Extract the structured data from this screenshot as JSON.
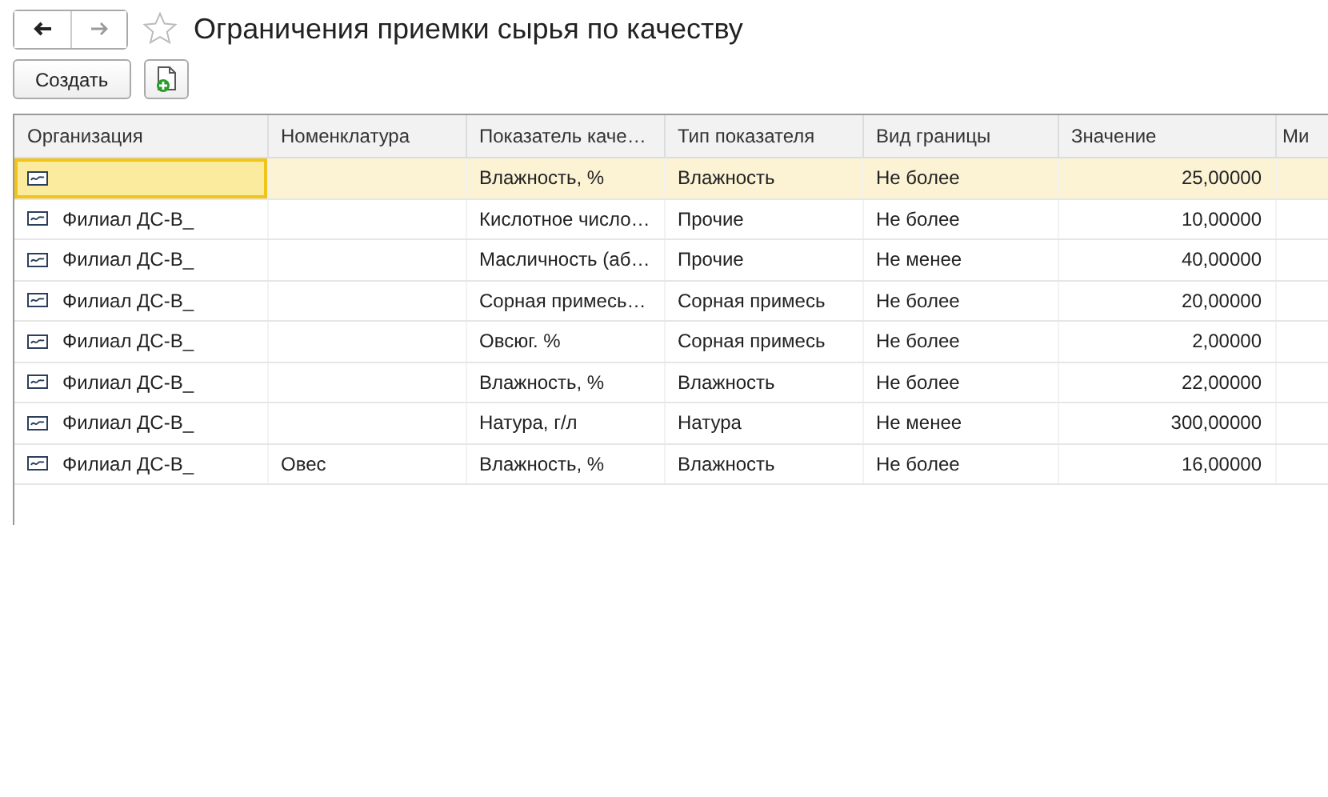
{
  "window": {
    "title": "Ограничения приемки сырья по качеству"
  },
  "toolbar": {
    "create_button": "Создать"
  },
  "table": {
    "columns": [
      "Организация",
      "Номенклатура",
      "Показатель каче…",
      "Тип показателя",
      "Вид  границы",
      "Значение",
      "Ми"
    ],
    "rows": [
      {
        "selected": true,
        "cells": [
          "",
          "",
          "Влажность, %",
          "Влажность",
          "Не более",
          "25,00000",
          ""
        ]
      },
      {
        "selected": false,
        "cells": [
          "Филиал ДС-В_",
          "",
          "Кислотное число…",
          "Прочие",
          "Не более",
          "10,00000",
          ""
        ]
      },
      {
        "selected": false,
        "cells": [
          "Филиал ДС-В_",
          "",
          "Масличность (аб…",
          "Прочие",
          "Не менее",
          "40,00000",
          ""
        ]
      },
      {
        "selected": false,
        "cells": [
          "Филиал ДС-В_",
          "",
          "Сорная примесь…",
          "Сорная примесь",
          "Не более",
          "20,00000",
          ""
        ]
      },
      {
        "selected": false,
        "cells": [
          "Филиал ДС-В_",
          "",
          "Овсюг. %",
          "Сорная примесь",
          "Не более",
          "2,00000",
          ""
        ]
      },
      {
        "selected": false,
        "cells": [
          "Филиал ДС-В_",
          "",
          "Влажность, %",
          "Влажность",
          "Не более",
          "22,00000",
          ""
        ]
      },
      {
        "selected": false,
        "cells": [
          "Филиал ДС-В_",
          "",
          "Натура, г/л",
          "Натура",
          "Не менее",
          "300,00000",
          ""
        ]
      },
      {
        "selected": false,
        "cells": [
          "Филиал ДС-В_",
          "Овес",
          "Влажность, %",
          "Влажность",
          "Не более",
          "16,00000",
          ""
        ]
      }
    ]
  }
}
